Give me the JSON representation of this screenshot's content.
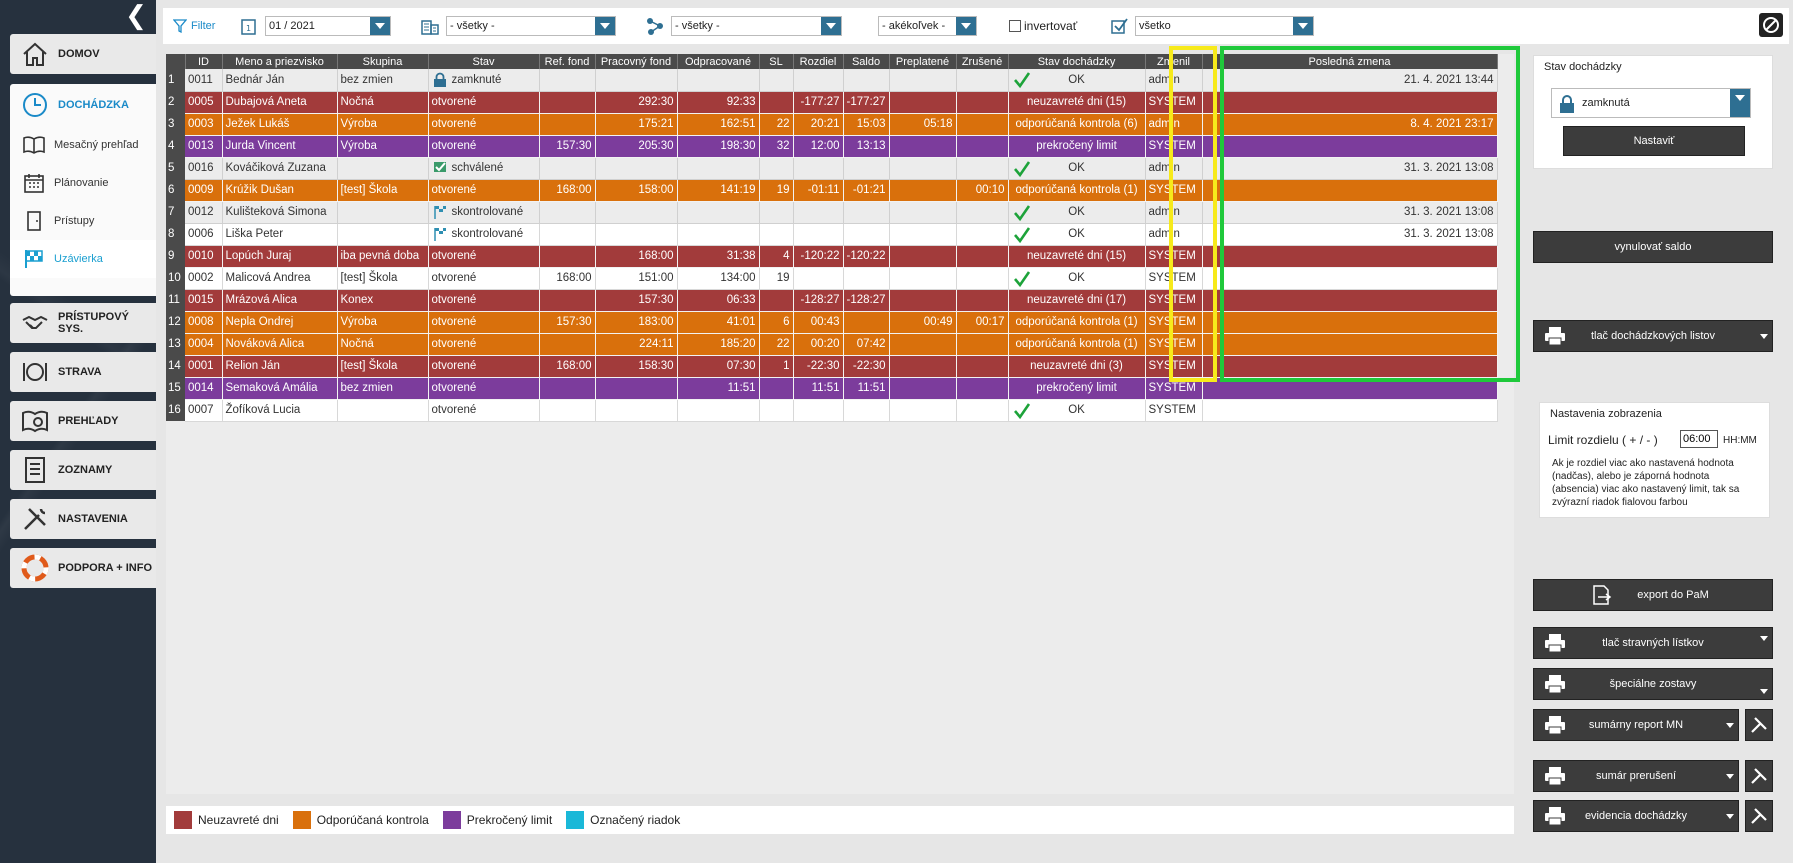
{
  "sidebar": {
    "domov": "DOMOV",
    "dochadzka": "DOCHÁDZKA",
    "sub": [
      "Mesačný prehľad",
      "Plánovanie",
      "Prístupy",
      "Uzávierka"
    ],
    "items": [
      "PRÍSTUPOVÝ SYS.",
      "STRAVA",
      "PREHĽADY",
      "ZOZNAMY",
      "NASTAVENIA",
      "PODPORA + INFO"
    ]
  },
  "toolbar": {
    "filter_label": "Filter",
    "month": "01 / 2021",
    "workplace": "- všetky -",
    "group": "- všetky -",
    "any": "- akékoľvek -",
    "invert_label": "invertovať",
    "status": "všetko"
  },
  "table": {
    "headers": [
      "ID",
      "Meno a priezvisko",
      "Skupina",
      "Stav",
      "Ref. fond",
      "Pracovný fond",
      "Odpracované",
      "SL",
      "Rozdiel",
      "Saldo",
      "Preplatené",
      "Zrušené",
      "Stav dochádzky",
      "Zmenil",
      "Posledná zmena"
    ],
    "rows": [
      {
        "n": "1",
        "id": "0011",
        "name": "Bednár Ján",
        "group": "bez zmien",
        "state": "zamknuté",
        "ref": "",
        "fond": "",
        "odp": "",
        "sl": "",
        "rozdiel": "",
        "saldo": "",
        "prep": "",
        "zrus": "",
        "stav": "OK",
        "zmenil": "admin",
        "zmena": "21. 4. 2021 13:44"
      },
      {
        "n": "2",
        "id": "0005",
        "name": "Dubajová Aneta",
        "group": "Nočná",
        "state": "otvorené",
        "ref": "",
        "fond": "292:30",
        "odp": "92:33",
        "sl": "",
        "rozdiel": "-177:27",
        "saldo": "-177:27",
        "prep": "",
        "zrus": "",
        "stav": "neuzavreté dni (15)",
        "zmenil": "SYSTEM",
        "zmena": ""
      },
      {
        "n": "3",
        "id": "0003",
        "name": "Ježek Lukáš",
        "group": "Výroba",
        "state": "otvorené",
        "ref": "",
        "fond": "175:21",
        "odp": "162:51",
        "sl": "22",
        "rozdiel": "20:21",
        "saldo": "15:03",
        "prep": "05:18",
        "zrus": "",
        "stav": "odporúčaná kontrola (6)",
        "zmenil": "admin",
        "zmena": "8. 4. 2021 23:17"
      },
      {
        "n": "4",
        "id": "0013",
        "name": "Jurda Vincent",
        "group": "Výroba",
        "state": "otvorené",
        "ref": "157:30",
        "fond": "205:30",
        "odp": "198:30",
        "sl": "32",
        "rozdiel": "12:00",
        "saldo": "13:13",
        "prep": "",
        "zrus": "",
        "stav": "prekročený limit",
        "zmenil": "SYSTEM",
        "zmena": ""
      },
      {
        "n": "5",
        "id": "0016",
        "name": "Kováčiková Zuzana",
        "group": "",
        "state": "schválené",
        "ref": "",
        "fond": "",
        "odp": "",
        "sl": "",
        "rozdiel": "",
        "saldo": "",
        "prep": "",
        "zrus": "",
        "stav": "OK",
        "zmenil": "admin",
        "zmena": "31. 3. 2021 13:08"
      },
      {
        "n": "6",
        "id": "0009",
        "name": "Krúžik Dušan",
        "group": "[test] Škola",
        "state": "otvorené",
        "ref": "168:00",
        "fond": "158:00",
        "odp": "141:19",
        "sl": "19",
        "rozdiel": "-01:11",
        "saldo": "-01:21",
        "prep": "",
        "zrus": "00:10",
        "stav": "odporúčaná kontrola (1)",
        "zmenil": "SYSTEM",
        "zmena": ""
      },
      {
        "n": "7",
        "id": "0012",
        "name": "Kulišteková Simona",
        "group": "",
        "state": "skontrolované",
        "ref": "",
        "fond": "",
        "odp": "",
        "sl": "",
        "rozdiel": "",
        "saldo": "",
        "prep": "",
        "zrus": "",
        "stav": "OK",
        "zmenil": "admin",
        "zmena": "31. 3. 2021 13:08"
      },
      {
        "n": "8",
        "id": "0006",
        "name": "Liška Peter",
        "group": "",
        "state": "skontrolované",
        "ref": "",
        "fond": "",
        "odp": "",
        "sl": "",
        "rozdiel": "",
        "saldo": "",
        "prep": "",
        "zrus": "",
        "stav": "OK",
        "zmenil": "admin",
        "zmena": "31. 3. 2021 13:08"
      },
      {
        "n": "9",
        "id": "0010",
        "name": "Lopúch Juraj",
        "group": "iba pevná doba",
        "state": "otvorené",
        "ref": "",
        "fond": "168:00",
        "odp": "31:38",
        "sl": "4",
        "rozdiel": "-120:22",
        "saldo": "-120:22",
        "prep": "",
        "zrus": "",
        "stav": "neuzavreté dni (15)",
        "zmenil": "SYSTEM",
        "zmena": ""
      },
      {
        "n": "10",
        "id": "0002",
        "name": "Malicová Andrea",
        "group": "[test] Škola",
        "state": "otvorené",
        "ref": "168:00",
        "fond": "151:00",
        "odp": "134:00",
        "sl": "19",
        "rozdiel": "",
        "saldo": "",
        "prep": "",
        "zrus": "",
        "stav": "OK",
        "zmenil": "SYSTEM",
        "zmena": ""
      },
      {
        "n": "11",
        "id": "0015",
        "name": "Mrázová Alica",
        "group": "Konex",
        "state": "otvorené",
        "ref": "",
        "fond": "157:30",
        "odp": "06:33",
        "sl": "",
        "rozdiel": "-128:27",
        "saldo": "-128:27",
        "prep": "",
        "zrus": "",
        "stav": "neuzavreté dni (17)",
        "zmenil": "SYSTEM",
        "zmena": ""
      },
      {
        "n": "12",
        "id": "0008",
        "name": "Nepla Ondrej",
        "group": "Výroba",
        "state": "otvorené",
        "ref": "157:30",
        "fond": "183:00",
        "odp": "41:01",
        "sl": "6",
        "rozdiel": "00:43",
        "saldo": "",
        "prep": "00:49",
        "zrus": "00:17",
        "stav": "odporúčaná kontrola (1)",
        "zmenil": "SYSTEM",
        "zmena": ""
      },
      {
        "n": "13",
        "id": "0004",
        "name": "Nováková Alica",
        "group": "Nočná",
        "state": "otvorené",
        "ref": "",
        "fond": "224:11",
        "odp": "185:20",
        "sl": "22",
        "rozdiel": "00:20",
        "saldo": "07:42",
        "prep": "",
        "zrus": "",
        "stav": "odporúčaná kontrola (1)",
        "zmenil": "SYSTEM",
        "zmena": ""
      },
      {
        "n": "14",
        "id": "0001",
        "name": "Relion Ján",
        "group": "[test] Škola",
        "state": "otvorené",
        "ref": "168:00",
        "fond": "158:30",
        "odp": "07:30",
        "sl": "1",
        "rozdiel": "-22:30",
        "saldo": "-22:30",
        "prep": "",
        "zrus": "",
        "stav": "neuzavreté dni (3)",
        "zmenil": "SYSTEM",
        "zmena": ""
      },
      {
        "n": "15",
        "id": "0014",
        "name": "Semaková Amália",
        "group": "bez zmien",
        "state": "otvorené",
        "ref": "",
        "fond": "",
        "odp": "11:51",
        "sl": "",
        "rozdiel": "11:51",
        "saldo": "11:51",
        "prep": "",
        "zrus": "",
        "stav": "prekročený limit",
        "zmenil": "SYSTEM",
        "zmena": ""
      },
      {
        "n": "16",
        "id": "0007",
        "name": "Žofíková Lucia",
        "group": "",
        "state": "otvorené",
        "ref": "",
        "fond": "",
        "odp": "",
        "sl": "",
        "rozdiel": "",
        "saldo": "",
        "prep": "",
        "zrus": "",
        "stav": "OK",
        "zmenil": "SYSTEM",
        "zmena": ""
      }
    ]
  },
  "legend": [
    "Neuzavreté dni",
    "Odporúčaná kontrola",
    "Prekročený limit",
    "Označený riadok"
  ],
  "colors": {
    "red": "#a23b3b",
    "orange": "#d9700c",
    "purple": "#7c3c9c",
    "cyan": "#1ab8d8",
    "accent": "#1a8ac8"
  },
  "right": {
    "stav_title": "Stav dochádzky",
    "stav_value": "zamknutá",
    "nastavit": "Nastaviť",
    "vynulovat": "vynulovať saldo",
    "tlac_dochadz": "tlač dochádzkových listov",
    "nastavenia_title": "Nastavenia zobrazenia",
    "limit_label": "Limit rozdielu ( + / - )",
    "limit_value": "06:00",
    "limit_unit": "HH:MM",
    "hint": "Ak je rozdiel viac ako nastavená hodnota (nadčas), alebo je záporná hodnota (absencia) viac ako nastavený limit, tak sa zvýrazní riadok fialovou farbou",
    "export": "export do PaM",
    "tlac_strav": "tlač stravných lístkov",
    "specialne": "špeciálne zostavy",
    "sumarny": "sumárny report MN",
    "sumar_prer": "sumár prerušení",
    "evidencia": "evidencia dochádzky"
  }
}
